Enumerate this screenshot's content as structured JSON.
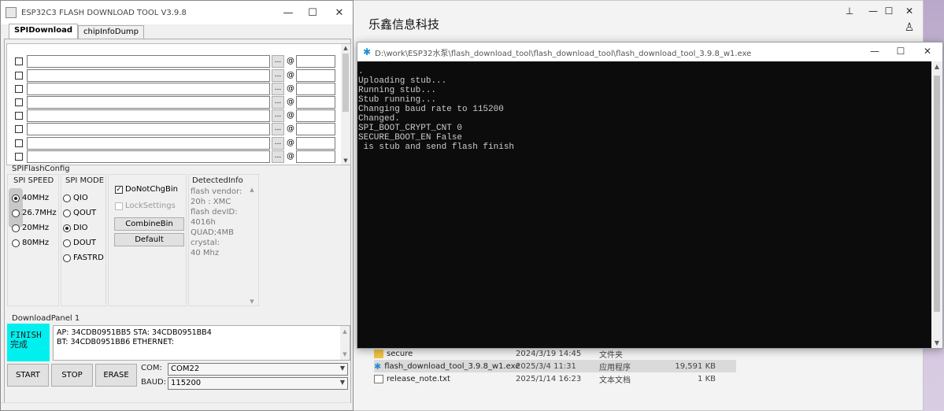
{
  "explorer": {
    "title": "乐鑫信息科技",
    "files": [
      {
        "name": "secure",
        "date": "2024/3/19 14:45",
        "type": "文件夹",
        "size": "",
        "icon": "folder-icon",
        "selected": false
      },
      {
        "name": "flash_download_tool_3.9.8_w1.exe",
        "date": "2025/3/4 11:31",
        "type": "应用程序",
        "size": "19,591 KB",
        "icon": "exe-icon",
        "selected": true
      },
      {
        "name": "release_note.txt",
        "date": "2025/1/14 16:23",
        "type": "文本文档",
        "size": "1 KB",
        "icon": "text-file-icon",
        "selected": false
      }
    ]
  },
  "console": {
    "title": "D:\\work\\ESP32水泵\\flash_download_tool\\flash_download_tool\\flash_download_tool_3.9.8_w1.exe",
    "lines": [
      ".",
      "Uploading stub...",
      "Running stub...",
      "Stub running...",
      "Changing baud rate to 115200",
      "Changed.",
      "SPI_BOOT_CRYPT_CNT 0",
      "SECURE_BOOT_EN False",
      "",
      " is stub and send flash finish"
    ]
  },
  "tool": {
    "title": "ESP32C3 FLASH DOWNLOAD TOOL V3.9.8",
    "tabs": [
      "SPIDownload",
      "chipInfoDump"
    ],
    "browse_label": "...",
    "at_label": "@",
    "spi_flash_config_label": "SPIFlashConfig",
    "spi_speed": {
      "label": "SPI SPEED",
      "options": [
        "40MHz",
        "26.7MHz",
        "20MHz",
        "80MHz"
      ],
      "selected": "40MHz"
    },
    "spi_mode": {
      "label": "SPI MODE",
      "options": [
        "QIO",
        "QOUT",
        "DIO",
        "DOUT",
        "FASTRD"
      ],
      "selected": "DIO"
    },
    "do_not_chg_bin": {
      "label": "DoNotChgBin",
      "checked": true
    },
    "lock_settings": {
      "label": "LockSettings",
      "checked": false
    },
    "combine_bin_label": "CombineBin",
    "default_label": "Default",
    "detected_info": {
      "label": "DetectedInfo",
      "lines": [
        "flash vendor:",
        "20h : XMC",
        "flash devID:",
        "4016h",
        "QUAD;4MB",
        "crystal:",
        "40 Mhz"
      ]
    },
    "download_panel_label": "DownloadPanel 1",
    "status": {
      "line1": "FINISH",
      "line2": "完成",
      "color": "#00f0f0"
    },
    "mac_info": {
      "line1": "AP:  34CDB0951BB5  STA:  34CDB0951BB4",
      "line2": "BT:  34CDB0951BB6  ETHERNET:"
    },
    "start_label": "START",
    "stop_label": "STOP",
    "erase_label": "ERASE",
    "com_label": "COM:",
    "com_value": "COM22",
    "baud_label": "BAUD:",
    "baud_value": "115200"
  }
}
